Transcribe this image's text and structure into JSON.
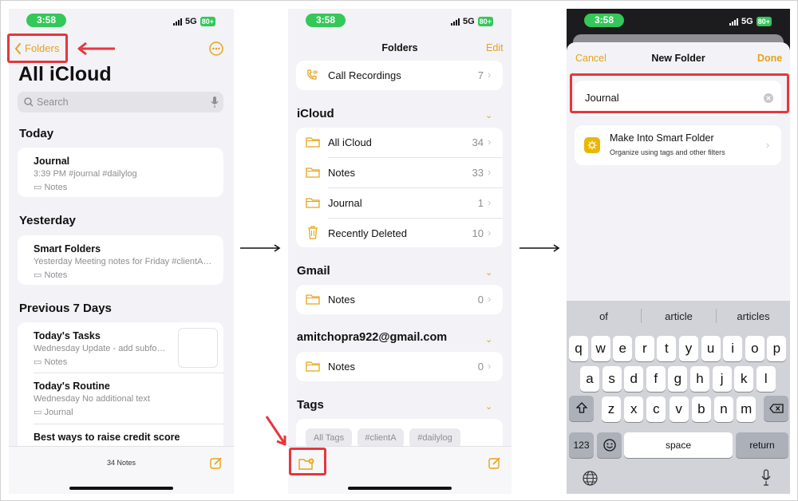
{
  "screen1": {
    "time": "3:58",
    "network": "5G",
    "battery": "80+",
    "back_label": "Folders",
    "title": "All iCloud",
    "search_placeholder": "Search",
    "sections": [
      {
        "title": "Today"
      },
      {
        "title": "Yesterday"
      },
      {
        "title": "Previous 7 Days"
      }
    ],
    "notes": [
      {
        "title": "Journal",
        "meta": "3:39 PM  #journal #dailylog",
        "folder": "Notes"
      },
      {
        "title": "Smart Folders",
        "meta": "Yesterday  Meeting notes for Friday #clientA…",
        "folder": "Notes"
      },
      {
        "title": "Today's Tasks",
        "meta": "Wednesday  Update - add subfo…",
        "folder": "Notes"
      },
      {
        "title": "Today's Routine",
        "meta": "Wednesday  No additional text",
        "folder": "Journal"
      },
      {
        "title": "Best ways to raise credit score"
      }
    ],
    "footer_count": "34 Notes"
  },
  "screen2": {
    "time": "3:58",
    "network": "5G",
    "battery": "80+",
    "title": "Folders",
    "edit_label": "Edit",
    "call_recordings": {
      "label": "Call Recordings",
      "count": "7"
    },
    "icloud_title": "iCloud",
    "icloud_folders": [
      {
        "label": "All iCloud",
        "count": "34",
        "icon": "folder-icon"
      },
      {
        "label": "Notes",
        "count": "33",
        "icon": "folder-icon"
      },
      {
        "label": "Journal",
        "count": "1",
        "icon": "folder-icon"
      },
      {
        "label": "Recently Deleted",
        "count": "10",
        "icon": "trash-icon"
      }
    ],
    "gmail_title": "Gmail",
    "gmail_folders": [
      {
        "label": "Notes",
        "count": "0"
      }
    ],
    "account_title": "amitchopra922@gmail.com",
    "account_folders": [
      {
        "label": "Notes",
        "count": "0"
      }
    ],
    "tags_title": "Tags",
    "tags": [
      "All Tags",
      "#clientA",
      "#dailylog"
    ]
  },
  "screen3": {
    "time": "3:58",
    "network": "5G",
    "battery": "80+",
    "cancel_label": "Cancel",
    "title": "New Folder",
    "done_label": "Done",
    "folder_name_value": "Journal",
    "smart_folder": {
      "title": "Make Into Smart Folder",
      "subtitle": "Organize using tags and other filters"
    },
    "suggestions": [
      "of",
      "article",
      "articles"
    ],
    "keyboard_rows": [
      [
        "q",
        "w",
        "e",
        "r",
        "t",
        "y",
        "u",
        "i",
        "o",
        "p"
      ],
      [
        "a",
        "s",
        "d",
        "f",
        "g",
        "h",
        "j",
        "k",
        "l"
      ],
      [
        "z",
        "x",
        "c",
        "v",
        "b",
        "n",
        "m"
      ]
    ],
    "num_key": "123",
    "space_key": "space",
    "return_key": "return"
  },
  "colors": {
    "accent": "#e8a317",
    "highlight": "#e5373d",
    "status_green": "#34c759"
  }
}
